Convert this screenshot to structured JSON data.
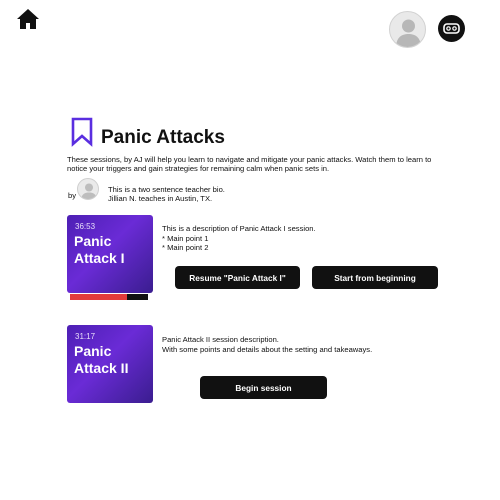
{
  "header": {
    "home_icon": "home-icon",
    "avatar_icon": "user-avatar-icon",
    "vr_icon": "vr-headset-icon"
  },
  "course": {
    "title": "Panic Attacks",
    "bookmark_icon": "bookmark-icon",
    "accent_color": "#5a2ee0",
    "description": "These sessions, by AJ will help you learn to navigate and mitigate your panic attacks. Watch them to learn to notice your triggers and gain strategies for remaining calm when panic sets in.",
    "by_label": "by",
    "teacher": {
      "bio_line1": "This is a two sentence teacher bio.",
      "bio_line2": "Jillian N. teaches in Austin, TX."
    }
  },
  "sessions": [
    {
      "time": "36:53",
      "title": "Panic Attack I",
      "description": "This is a description of Panic Attack I session.",
      "points": [
        "* Main point 1",
        "* Main point 2"
      ],
      "progress_fraction": 0.73,
      "progress_color": "#e23b3b",
      "resume_label": "Resume \"Panic Attack I\"",
      "restart_label": "Start from beginning"
    },
    {
      "time": "31:17",
      "title": "Panic Attack II",
      "description_line1": "Panic Attack II session description.",
      "description_line2": "With some points and details about the setting and takeaways.",
      "begin_label": "Begin session"
    }
  ]
}
